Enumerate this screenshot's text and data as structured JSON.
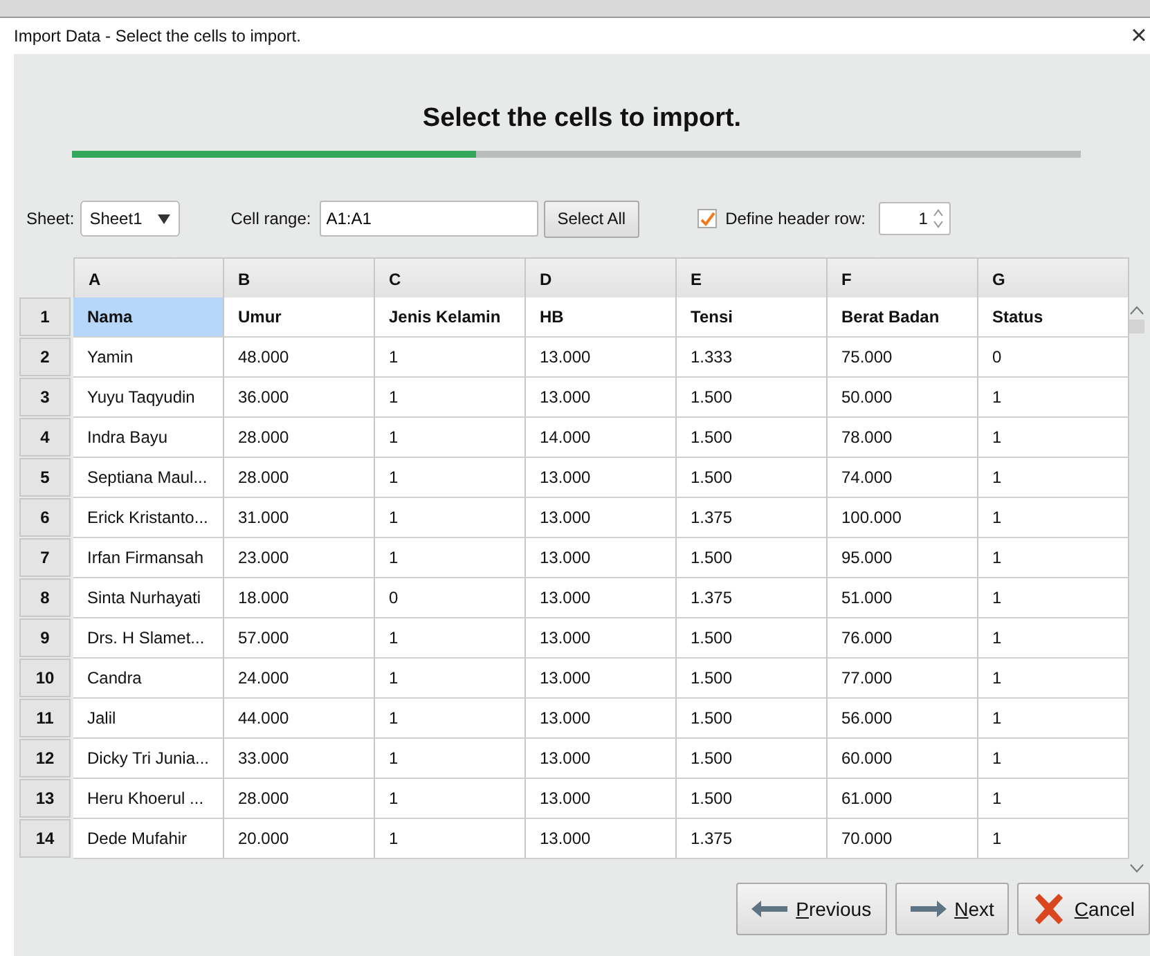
{
  "window": {
    "title": "Import Data - Select the cells to import.",
    "close": "×"
  },
  "heading": "Select the cells to import.",
  "progress": {
    "level": 0.4
  },
  "controls": {
    "sheet_label": "Sheet:",
    "sheet": "Sheet1",
    "range_label": "Cell range:",
    "range": "A1:A1",
    "select_all": "Select All",
    "header_checkbox": {
      "label": "Define header row:",
      "checked": true
    },
    "header_row": "1"
  },
  "table": {
    "columns": [
      "A",
      "B",
      "C",
      "D",
      "E",
      "F",
      "G"
    ],
    "rows": [
      {
        "number": "1",
        "header": true,
        "cells": [
          {
            "text": "Nama",
            "selected": true
          },
          {
            "text": "Umur",
            "selected": false
          },
          {
            "text": "Jenis Kelamin",
            "selected": false
          },
          {
            "text": "HB",
            "selected": false
          },
          {
            "text": "Tensi",
            "selected": false
          },
          {
            "text": "Berat Badan",
            "selected": false
          },
          {
            "text": "Status",
            "selected": false
          }
        ]
      },
      {
        "number": "2",
        "header": false,
        "cells": [
          {
            "text": "Yamin",
            "selected": false
          },
          {
            "text": "48.000",
            "selected": false
          },
          {
            "text": "1",
            "selected": false
          },
          {
            "text": "13.000",
            "selected": false
          },
          {
            "text": "1.333",
            "selected": false
          },
          {
            "text": "75.000",
            "selected": false
          },
          {
            "text": "0",
            "selected": false
          }
        ]
      },
      {
        "number": "3",
        "header": false,
        "cells": [
          {
            "text": "Yuyu Taqyudin",
            "selected": false
          },
          {
            "text": "36.000",
            "selected": false
          },
          {
            "text": "1",
            "selected": false
          },
          {
            "text": "13.000",
            "selected": false
          },
          {
            "text": "1.500",
            "selected": false
          },
          {
            "text": "50.000",
            "selected": false
          },
          {
            "text": "1",
            "selected": false
          }
        ]
      },
      {
        "number": "4",
        "header": false,
        "cells": [
          {
            "text": "Indra Bayu",
            "selected": false
          },
          {
            "text": "28.000",
            "selected": false
          },
          {
            "text": "1",
            "selected": false
          },
          {
            "text": "14.000",
            "selected": false
          },
          {
            "text": "1.500",
            "selected": false
          },
          {
            "text": "78.000",
            "selected": false
          },
          {
            "text": "1",
            "selected": false
          }
        ]
      },
      {
        "number": "5",
        "header": false,
        "cells": [
          {
            "text": "Septiana Maul...",
            "selected": false
          },
          {
            "text": "28.000",
            "selected": false
          },
          {
            "text": "1",
            "selected": false
          },
          {
            "text": "13.000",
            "selected": false
          },
          {
            "text": "1.500",
            "selected": false
          },
          {
            "text": "74.000",
            "selected": false
          },
          {
            "text": "1",
            "selected": false
          }
        ]
      },
      {
        "number": "6",
        "header": false,
        "cells": [
          {
            "text": "Erick Kristanto...",
            "selected": false
          },
          {
            "text": "31.000",
            "selected": false
          },
          {
            "text": "1",
            "selected": false
          },
          {
            "text": "13.000",
            "selected": false
          },
          {
            "text": "1.375",
            "selected": false
          },
          {
            "text": "100.000",
            "selected": false
          },
          {
            "text": "1",
            "selected": false
          }
        ]
      },
      {
        "number": "7",
        "header": false,
        "cells": [
          {
            "text": "Irfan Firmansah",
            "selected": false
          },
          {
            "text": "23.000",
            "selected": false
          },
          {
            "text": "1",
            "selected": false
          },
          {
            "text": "13.000",
            "selected": false
          },
          {
            "text": "1.500",
            "selected": false
          },
          {
            "text": "95.000",
            "selected": false
          },
          {
            "text": "1",
            "selected": false
          }
        ]
      },
      {
        "number": "8",
        "header": false,
        "cells": [
          {
            "text": "Sinta Nurhayati",
            "selected": false
          },
          {
            "text": "18.000",
            "selected": false
          },
          {
            "text": "0",
            "selected": false
          },
          {
            "text": "13.000",
            "selected": false
          },
          {
            "text": "1.375",
            "selected": false
          },
          {
            "text": "51.000",
            "selected": false
          },
          {
            "text": "1",
            "selected": false
          }
        ]
      },
      {
        "number": "9",
        "header": false,
        "cells": [
          {
            "text": "Drs. H Slamet...",
            "selected": false
          },
          {
            "text": "57.000",
            "selected": false
          },
          {
            "text": "1",
            "selected": false
          },
          {
            "text": "13.000",
            "selected": false
          },
          {
            "text": "1.500",
            "selected": false
          },
          {
            "text": "76.000",
            "selected": false
          },
          {
            "text": "1",
            "selected": false
          }
        ]
      },
      {
        "number": "10",
        "header": false,
        "cells": [
          {
            "text": "Candra",
            "selected": false
          },
          {
            "text": "24.000",
            "selected": false
          },
          {
            "text": "1",
            "selected": false
          },
          {
            "text": "13.000",
            "selected": false
          },
          {
            "text": "1.500",
            "selected": false
          },
          {
            "text": "77.000",
            "selected": false
          },
          {
            "text": "1",
            "selected": false
          }
        ]
      },
      {
        "number": "11",
        "header": false,
        "cells": [
          {
            "text": "Jalil",
            "selected": false
          },
          {
            "text": "44.000",
            "selected": false
          },
          {
            "text": "1",
            "selected": false
          },
          {
            "text": "13.000",
            "selected": false
          },
          {
            "text": "1.500",
            "selected": false
          },
          {
            "text": "56.000",
            "selected": false
          },
          {
            "text": "1",
            "selected": false
          }
        ]
      },
      {
        "number": "12",
        "header": false,
        "cells": [
          {
            "text": "Dicky Tri Junia...",
            "selected": false
          },
          {
            "text": "33.000",
            "selected": false
          },
          {
            "text": "1",
            "selected": false
          },
          {
            "text": "13.000",
            "selected": false
          },
          {
            "text": "1.500",
            "selected": false
          },
          {
            "text": "60.000",
            "selected": false
          },
          {
            "text": "1",
            "selected": false
          }
        ]
      },
      {
        "number": "13",
        "header": false,
        "cells": [
          {
            "text": "Heru Khoerul ...",
            "selected": false
          },
          {
            "text": "28.000",
            "selected": false
          },
          {
            "text": "1",
            "selected": false
          },
          {
            "text": "13.000",
            "selected": false
          },
          {
            "text": "1.500",
            "selected": false
          },
          {
            "text": "61.000",
            "selected": false
          },
          {
            "text": "1",
            "selected": false
          }
        ]
      },
      {
        "number": "14",
        "header": false,
        "cells": [
          {
            "text": "Dede Mufahir",
            "selected": false
          },
          {
            "text": "20.000",
            "selected": false
          },
          {
            "text": "1",
            "selected": false
          },
          {
            "text": "13.000",
            "selected": false
          },
          {
            "text": "1.375",
            "selected": false
          },
          {
            "text": "70.000",
            "selected": false
          },
          {
            "text": "1",
            "selected": false
          }
        ]
      }
    ]
  },
  "buttons": [
    {
      "kind": "previous",
      "label": "Previous"
    },
    {
      "kind": "next",
      "label": "Next"
    },
    {
      "kind": "cancel",
      "label": "Cancel"
    }
  ]
}
